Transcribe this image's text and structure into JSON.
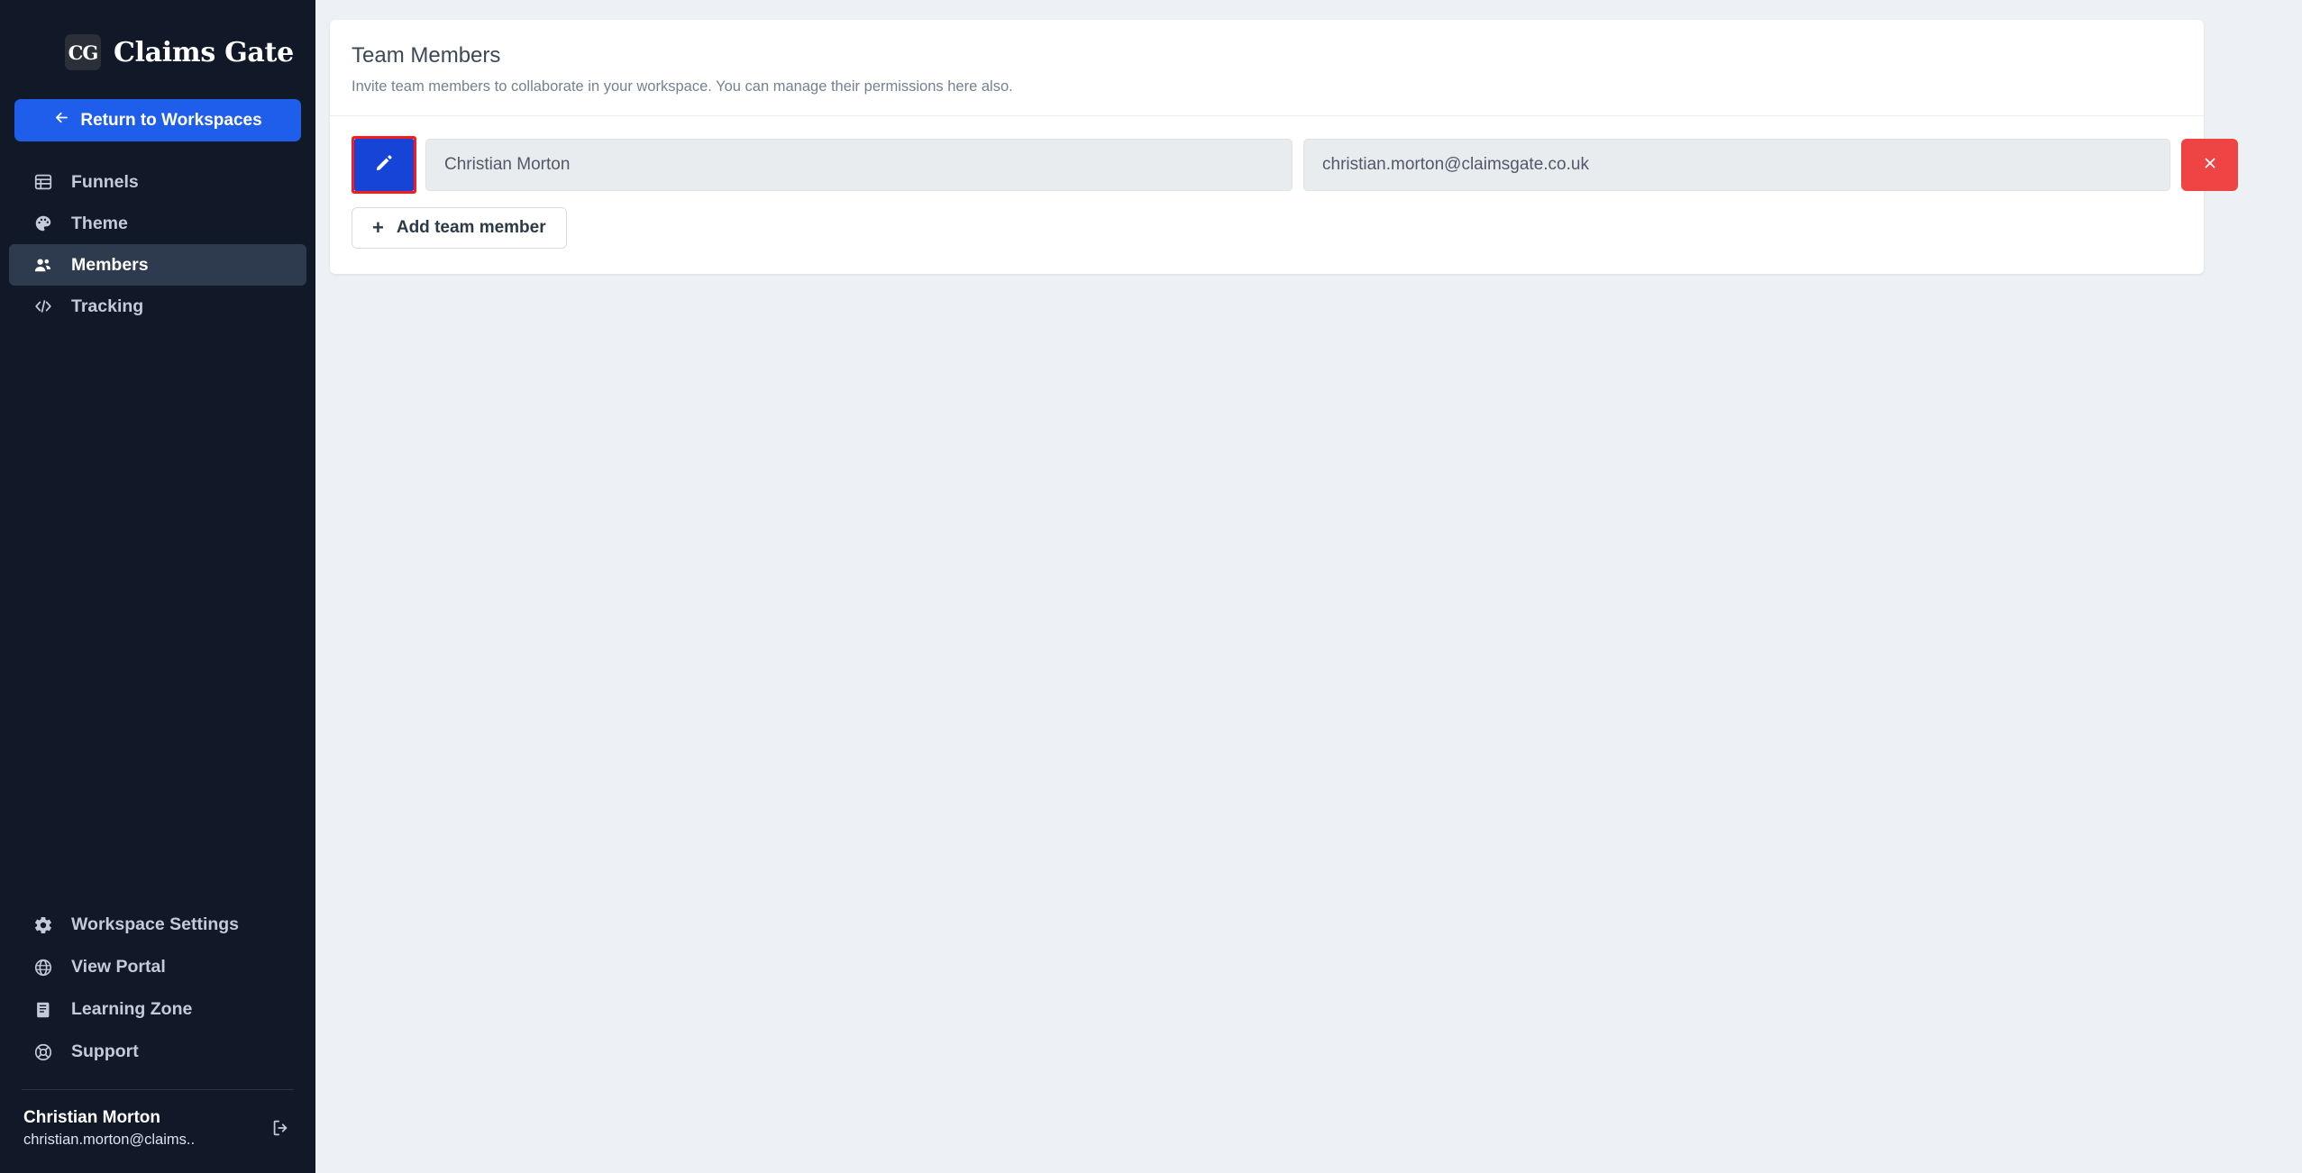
{
  "sidebar": {
    "brand": {
      "logo_text": "CG",
      "name": "Claims Gate",
      "logo_icon": "claims-gate-logo"
    },
    "return_button": {
      "label": "Return to Workspaces",
      "icon": "arrow-left-icon",
      "color": "#1f5eeb"
    },
    "nav_items": [
      {
        "label": "Funnels",
        "icon": "table-icon",
        "active": false
      },
      {
        "label": "Theme",
        "icon": "palette-icon",
        "active": false
      },
      {
        "label": "Members",
        "icon": "users-icon",
        "active": true
      },
      {
        "label": "Tracking",
        "icon": "code-icon",
        "active": false
      }
    ],
    "footer_items": [
      {
        "label": "Workspace Settings",
        "icon": "gear-icon"
      },
      {
        "label": "View Portal",
        "icon": "globe-icon"
      },
      {
        "label": "Learning Zone",
        "icon": "book-icon"
      },
      {
        "label": "Support",
        "icon": "lifebuoy-icon"
      }
    ],
    "user": {
      "name": "Christian Morton",
      "email": "christian.morton@claims..",
      "logout_icon": "logout-icon"
    },
    "active_color": "#2e3a4d",
    "background_color": "#111827"
  },
  "main": {
    "card": {
      "title": "Team Members",
      "subtitle": "Invite team members to collaborate in your workspace. You can manage their permissions here also.",
      "members": [
        {
          "edit_icon": "pencil-icon",
          "name": "Christian Morton",
          "email": "christian.morton@claimsgate.co.uk",
          "delete_icon": "close-icon",
          "highlighted": true
        }
      ],
      "add_button": {
        "label": "Add team member",
        "icon": "plus-icon"
      }
    }
  },
  "colors": {
    "highlight_outline": "#f41d1d",
    "edit_button": "#1644d6",
    "delete_button": "#ef4444",
    "page_background": "#edf0f5"
  }
}
